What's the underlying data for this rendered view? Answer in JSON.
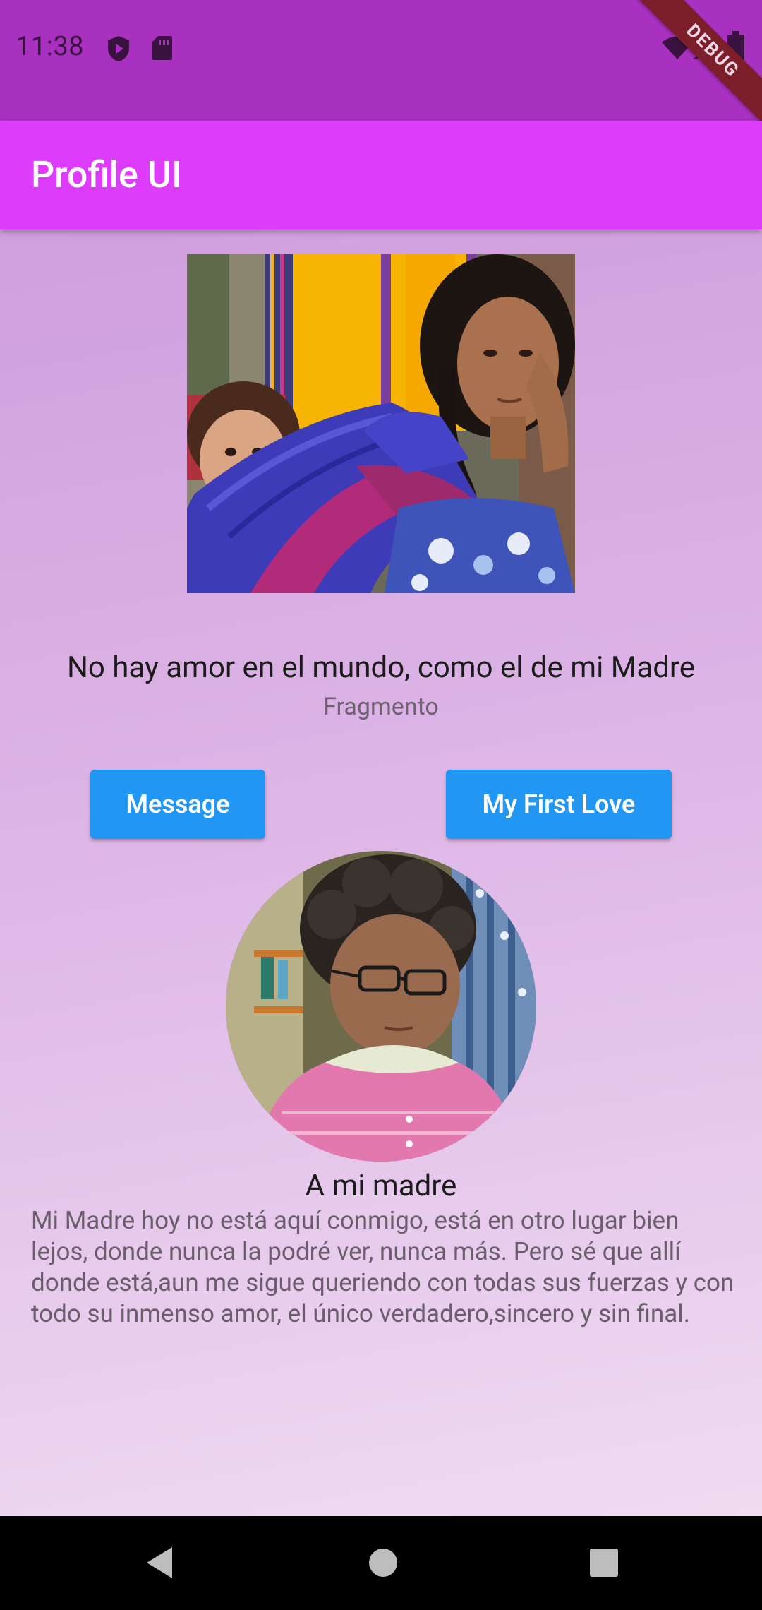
{
  "status_bar": {
    "time": "11:38",
    "icons": [
      "shield-play-icon",
      "sd-card-icon",
      "wifi-icon",
      "signal-icon",
      "battery-icon"
    ]
  },
  "debug_banner": "DEBUG",
  "app_bar": {
    "title": "Profile UI"
  },
  "hero": {
    "image": "photo of woman carrying a child in a blue shawl"
  },
  "headline": "No hay amor en el mundo, como el de mi Madre",
  "subheadline": "Fragmento",
  "buttons": {
    "message_label": "Message",
    "first_love_label": "My First Love"
  },
  "avatar": {
    "image": "circular photo of an older woman with glasses"
  },
  "poem": {
    "title": "A mi madre",
    "body": "Mi Madre hoy no está aquí conmigo, está en otro lugar bien lejos, donde nunca la podré ver, nunca más. Pero sé que allí donde está,aun me sigue queriendo con todas sus fuerzas y con todo su inmenso amor, el único verdadero,sincero y sin final."
  },
  "colors": {
    "status_bar": "#a931c0",
    "app_bar": "#de3cfc",
    "button": "#2196f3",
    "background_top": "#cf9fdd",
    "background_bottom": "#efdcf1"
  },
  "nav_bar": {
    "icons": [
      "back-icon",
      "home-icon",
      "recents-icon"
    ]
  }
}
